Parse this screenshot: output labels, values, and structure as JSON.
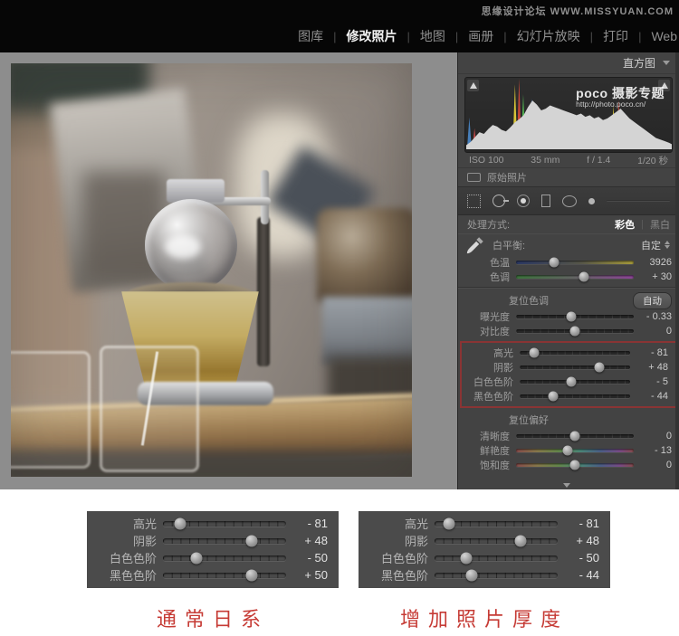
{
  "menu_bar": {
    "watermark": "思缘设计论坛 WWW.MISSYUAN.COM",
    "separator": "|",
    "items": [
      {
        "label": "图库",
        "active": false
      },
      {
        "label": "修改照片",
        "active": true
      },
      {
        "label": "地图",
        "active": false
      },
      {
        "label": "画册",
        "active": false
      },
      {
        "label": "幻灯片放映",
        "active": false
      },
      {
        "label": "打印",
        "active": false
      },
      {
        "label": "Web",
        "active": false
      }
    ]
  },
  "right_panel": {
    "histogram": {
      "title": "直方图",
      "watermark_line1": "poco 摄影专题",
      "watermark_line2": "http://photo.poco.cn/",
      "exif": {
        "iso": "ISO 100",
        "focal_length": "35 mm",
        "aperture": "f / 1.4",
        "shutter": "1/20 秒"
      },
      "gray_heights": [
        0.05,
        0.09,
        0.15,
        0.21,
        0.19,
        0.25,
        0.3,
        0.28,
        0.24,
        0.22,
        0.27,
        0.33,
        0.37,
        0.42,
        0.52,
        0.6,
        0.55,
        0.48,
        0.5,
        0.54,
        0.52,
        0.5,
        0.48,
        0.46,
        0.44,
        0.42,
        0.44,
        0.4,
        0.42,
        0.38,
        0.4,
        0.36,
        0.38,
        0.42,
        0.46,
        0.5,
        0.44,
        0.38,
        0.34,
        0.3,
        0.26,
        0.22,
        0.18,
        0.14,
        0.12,
        0.1,
        0.08,
        0.05
      ],
      "color_spikes": [
        {
          "x": 0.015,
          "h": 0.45,
          "c": "#4a87c8"
        },
        {
          "x": 0.04,
          "h": 0.3,
          "c": "#c84a4a"
        },
        {
          "x": 0.235,
          "h": 0.92,
          "c": "#e8d23a"
        },
        {
          "x": 0.255,
          "h": 1.0,
          "c": "#d94a3a"
        },
        {
          "x": 0.275,
          "h": 0.78,
          "c": "#58c858"
        },
        {
          "x": 0.315,
          "h": 0.72,
          "c": "#4a87e8"
        },
        {
          "x": 0.345,
          "h": 0.55,
          "c": "#4a87e8"
        },
        {
          "x": 0.4,
          "h": 0.45,
          "c": "#4ac8c8"
        },
        {
          "x": 0.445,
          "h": 0.42,
          "c": "#c84ac8"
        },
        {
          "x": 0.47,
          "h": 0.38,
          "c": "#d94a3a"
        },
        {
          "x": 0.52,
          "h": 0.34,
          "c": "#4a87e8"
        },
        {
          "x": 0.6,
          "h": 0.4,
          "c": "#4a87e8"
        },
        {
          "x": 0.655,
          "h": 0.35,
          "c": "#4ac8c8"
        },
        {
          "x": 0.71,
          "h": 0.62,
          "c": "#e8d23a"
        },
        {
          "x": 0.735,
          "h": 0.7,
          "c": "#d94a3a"
        },
        {
          "x": 0.765,
          "h": 0.52,
          "c": "#4a87e8"
        },
        {
          "x": 0.82,
          "h": 0.3,
          "c": "#d94a3a"
        },
        {
          "x": 0.87,
          "h": 0.22,
          "c": "#4a87e8"
        },
        {
          "x": 0.93,
          "h": 0.12,
          "c": "#c84a4a"
        }
      ]
    },
    "original_photo_label": "原始照片",
    "treatment": {
      "label": "处理方式:",
      "options": [
        {
          "label": "彩色",
          "active": true
        },
        {
          "label": "黑白",
          "active": false
        }
      ]
    },
    "white_balance": {
      "header": "白平衡:",
      "preset": "自定",
      "sliders": [
        {
          "label": "色温",
          "display": "3926",
          "pos": 0.32,
          "track": "temp"
        },
        {
          "label": "色调",
          "display": "+ 30",
          "pos": 0.58,
          "track": "tint"
        }
      ]
    },
    "tone": {
      "header": "复位色调",
      "auto_button": "自动",
      "sliders": [
        {
          "label": "曝光度",
          "display": "- 0.33",
          "pos": 0.47
        },
        {
          "label": "对比度",
          "display": "0",
          "pos": 0.5
        }
      ]
    },
    "tone_highlighted": {
      "sliders": [
        {
          "label": "高光",
          "display": "- 81",
          "pos": 0.13
        },
        {
          "label": "阴影",
          "display": "+ 48",
          "pos": 0.72
        },
        {
          "label": "白色色阶",
          "display": "- 5",
          "pos": 0.47
        },
        {
          "label": "黑色色阶",
          "display": "- 44",
          "pos": 0.3
        }
      ]
    },
    "presence": {
      "header": "复位偏好",
      "sliders": [
        {
          "label": "清晰度",
          "display": "0",
          "pos": 0.5
        },
        {
          "label": "鲜艳度",
          "display": "- 13",
          "pos": 0.44,
          "track": "rainbow"
        },
        {
          "label": "饱和度",
          "display": "0",
          "pos": 0.5,
          "track": "rainbow"
        }
      ]
    }
  },
  "comparison": {
    "panels": [
      {
        "caption": "通常日系",
        "sliders": [
          {
            "label": "高光",
            "display": "- 81",
            "pos": 0.14
          },
          {
            "label": "阴影",
            "display": "+ 48",
            "pos": 0.72
          },
          {
            "label": "白色色阶",
            "display": "- 50",
            "pos": 0.27
          },
          {
            "label": "黑色色阶",
            "display": "+ 50",
            "pos": 0.72
          }
        ]
      },
      {
        "caption": "增加照片厚度",
        "sliders": [
          {
            "label": "高光",
            "display": "- 81",
            "pos": 0.12
          },
          {
            "label": "阴影",
            "display": "+ 48",
            "pos": 0.7
          },
          {
            "label": "白色色阶",
            "display": "- 50",
            "pos": 0.26
          },
          {
            "label": "黑色色阶",
            "display": "- 44",
            "pos": 0.3
          }
        ]
      }
    ]
  },
  "colors": {
    "highlight_box_border": "#8a3434",
    "caption_red": "#c63b35",
    "panel_bg": "#434343",
    "menu_bg": "#060606"
  }
}
